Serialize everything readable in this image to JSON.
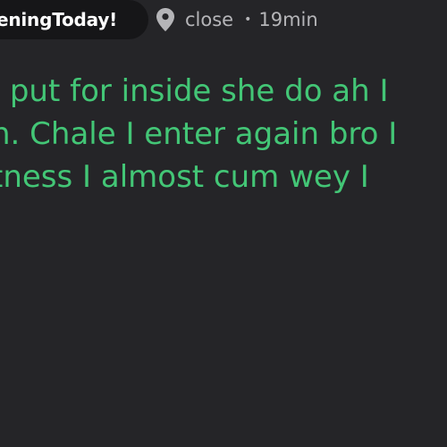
{
  "header": {
    "channel_name": "eningToday!",
    "location_icon": "location-pin-icon",
    "location": "close",
    "separator": "•",
    "time_ago": "19min"
  },
  "post": {
    "lines": [
      "I put for inside she do ah I",
      "n. Chale I enter again bro I",
      "tness I almost cum wey I"
    ]
  },
  "colors": {
    "background": "#252528",
    "pill": "#161618",
    "text_accent": "#43c676",
    "meta_text": "#b5b5b8"
  }
}
